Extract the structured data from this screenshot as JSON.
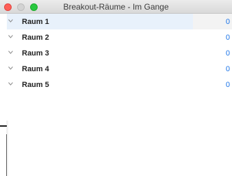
{
  "window": {
    "title": "Breakout-Räume - Im Gange"
  },
  "rooms": [
    {
      "label": "Raum 1",
      "count": "0",
      "selected": true
    },
    {
      "label": "Raum 2",
      "count": "0",
      "selected": false
    },
    {
      "label": "Raum 3",
      "count": "0",
      "selected": false
    },
    {
      "label": "Raum 4",
      "count": "0",
      "selected": false
    },
    {
      "label": "Raum 5",
      "count": "0",
      "selected": false
    }
  ],
  "colors": {
    "count": "#1a73e8",
    "selection": "#e8f1fb"
  },
  "icons": {
    "expand": "chevron-down-icon"
  }
}
